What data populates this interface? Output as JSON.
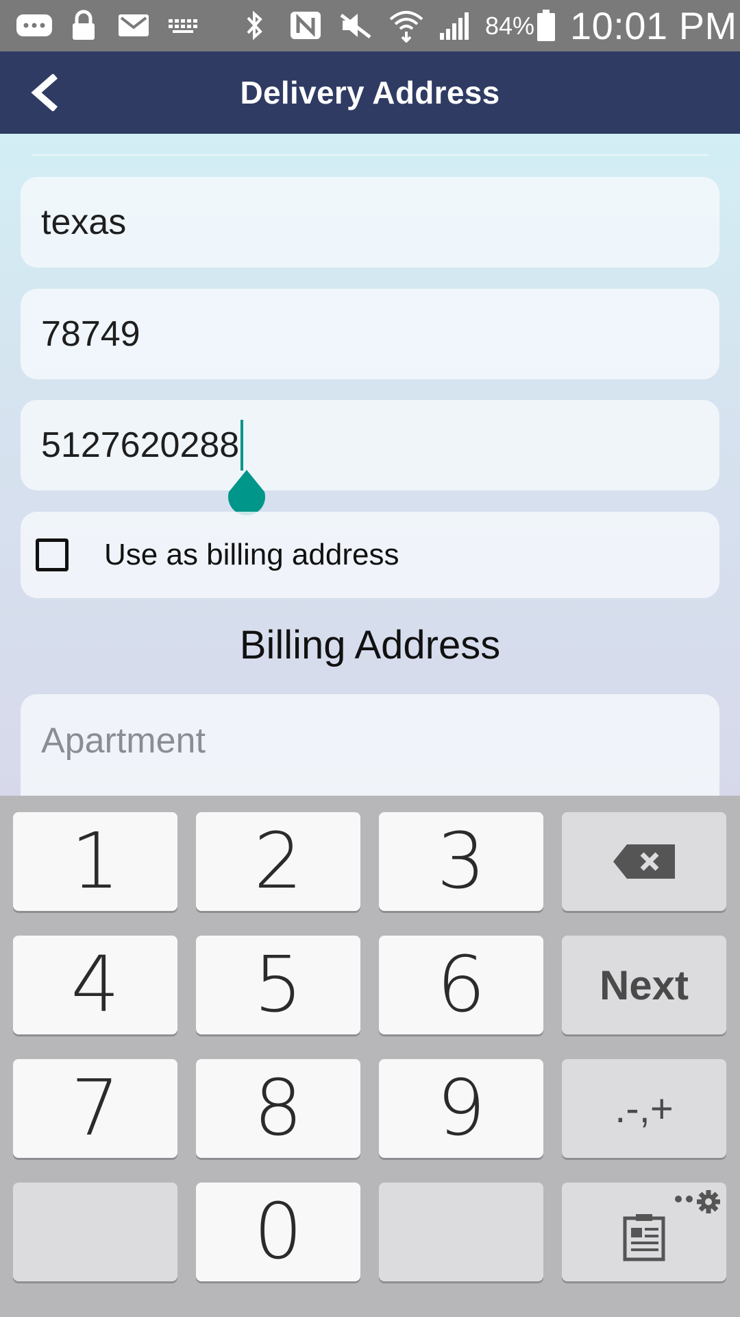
{
  "status_bar": {
    "icons": [
      "chat-icon",
      "lock-icon",
      "gmail-icon",
      "keyboard-icon",
      "bluetooth-icon",
      "nfc-icon",
      "mute-icon",
      "wifi-icon",
      "signal-icon",
      "battery-icon"
    ],
    "battery": "84%",
    "time": "10:01 PM"
  },
  "app_bar": {
    "title": "Delivery Address",
    "back_icon": "chevron-left-icon"
  },
  "form": {
    "state_value": "texas",
    "zip_value": "78749",
    "phone_value": "5127620288",
    "use_billing_label": "Use as billing address",
    "use_billing_checked": false,
    "billing_section_title": "Billing Address",
    "apartment_placeholder": "Apartment"
  },
  "keyboard": {
    "row1": [
      "1",
      "2",
      "3"
    ],
    "row2": [
      "4",
      "5",
      "6"
    ],
    "row3": [
      "7",
      "8",
      "9"
    ],
    "zero": "0",
    "next_label": "Next",
    "symbols_label": ".-,+",
    "backspace_icon": "backspace-icon",
    "clipboard_icon": "clipboard-icon",
    "settings_icon": "gear-icon"
  },
  "colors": {
    "app_bar": "#2f3b63",
    "status_bar": "#7a7a7a",
    "cursor": "#00968a",
    "keyboard_bg": "#b7b7ba"
  }
}
